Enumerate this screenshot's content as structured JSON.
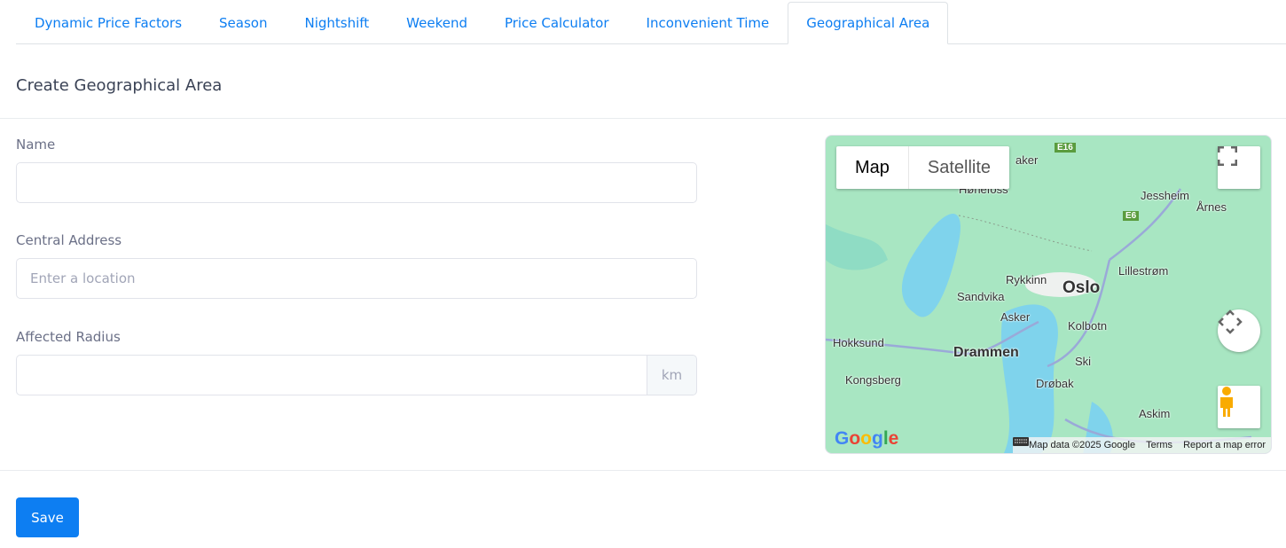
{
  "tabs": [
    {
      "label": "Dynamic Price Factors"
    },
    {
      "label": "Season"
    },
    {
      "label": "Nightshift"
    },
    {
      "label": "Weekend"
    },
    {
      "label": "Price Calculator"
    },
    {
      "label": "Inconvenient Time"
    },
    {
      "label": "Geographical Area",
      "active": true
    }
  ],
  "form": {
    "title": "Create Geographical Area",
    "name_label": "Name",
    "name_value": "",
    "address_label": "Central Address",
    "address_placeholder": "Enter a location",
    "radius_label": "Affected Radius",
    "radius_value": "",
    "radius_unit": "km",
    "save_label": "Save"
  },
  "map": {
    "type_map": "Map",
    "type_satellite": "Satellite",
    "cities": [
      "Hønefoss",
      "aker",
      "Jessheim",
      "Årnes",
      "Lillestrøm",
      "Rykkinn",
      "Oslo",
      "Sandvika",
      "Asker",
      "Kolbotn",
      "Hokksund",
      "Drammen",
      "Ski",
      "Kongsberg",
      "Drøbak",
      "Askim"
    ],
    "roads": [
      "E16",
      "E6"
    ],
    "logo": "Google",
    "attribution": {
      "data": "Map data ©2025 Google",
      "terms": "Terms",
      "report": "Report a map error"
    },
    "icons": [
      "fullscreen-icon",
      "camera-control-icon",
      "pegman-icon",
      "keyboard-icon"
    ]
  }
}
